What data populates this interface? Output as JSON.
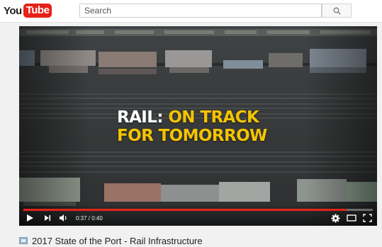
{
  "logo": {
    "you": "You",
    "tube": "Tube"
  },
  "search": {
    "placeholder": "Search",
    "icon": "search-icon"
  },
  "video": {
    "headline_line1_white": "RAIL: ",
    "headline_line1_yellow": "ON TRACK",
    "headline_line2_yellow": "FOR TOMORROW",
    "current_time": "0:37",
    "time_separator": " / ",
    "duration": "0:40",
    "progress_fraction": 0.925,
    "colors": {
      "accent": "#e62117",
      "headline_yellow": "#f4c400"
    }
  },
  "controls": {
    "play_icon": "play-icon",
    "next_icon": "next-icon",
    "volume_icon": "volume-icon",
    "settings_icon": "gear-icon",
    "theater_icon": "theater-mode-icon",
    "fullscreen_icon": "fullscreen-icon"
  },
  "title": {
    "text": "2017 State of the Port - Rail Infrastructure",
    "icon": "video-thumbnail-icon"
  }
}
